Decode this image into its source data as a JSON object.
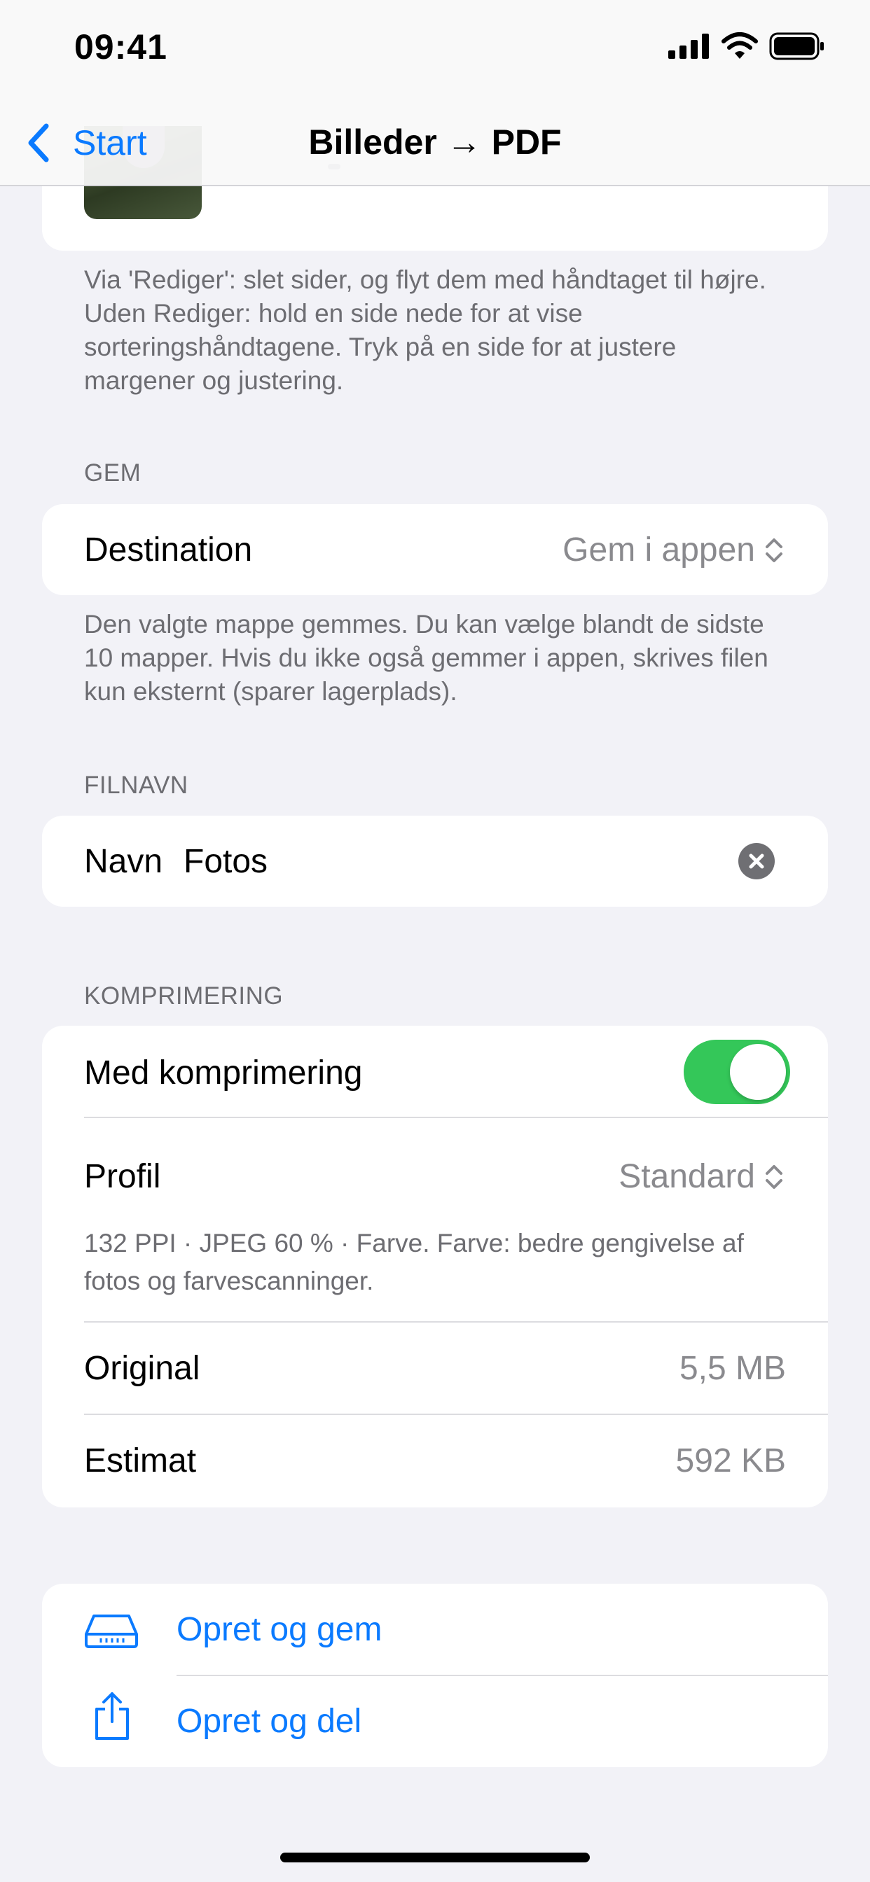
{
  "status_bar": {
    "time": "09:41"
  },
  "nav": {
    "back_label": "Start",
    "title": "Billeder → PDF"
  },
  "pages_footnote": "Via 'Rediger': slet sider, og flyt dem med håndtaget til højre. Uden Rediger: hold en side nede for at vise sorteringshåndtagene. Tryk på en side for at justere margener og justering.",
  "save_section": {
    "header": "GEM",
    "destination_label": "Destination",
    "destination_value": "Gem i appen",
    "footnote": "Den valgte mappe gemmes. Du kan vælge blandt de sidste 10 mapper. Hvis du ikke også gemmer i appen, skrives filen kun eksternt (sparer lagerplads)."
  },
  "filename_section": {
    "header": "FILNAVN",
    "label": "Navn",
    "value": "Fotos"
  },
  "compression_section": {
    "header": "KOMPRIMERING",
    "toggle_label": "Med komprimering",
    "toggle_on": true,
    "profile_label": "Profil",
    "profile_value": "Standard",
    "profile_description": "132 PPI · JPEG 60 % · Farve. Farve: bedre gengivelse af fotos og farvescanninger.",
    "original_label": "Original",
    "original_value": "5,5 MB",
    "estimate_label": "Estimat",
    "estimate_value": "592 KB"
  },
  "actions": {
    "create_save_label": "Opret og gem",
    "create_share_label": "Opret og del"
  },
  "colors": {
    "accent": "#0a7aff",
    "toggle_on": "#34c759",
    "background": "#f2f2f7"
  }
}
